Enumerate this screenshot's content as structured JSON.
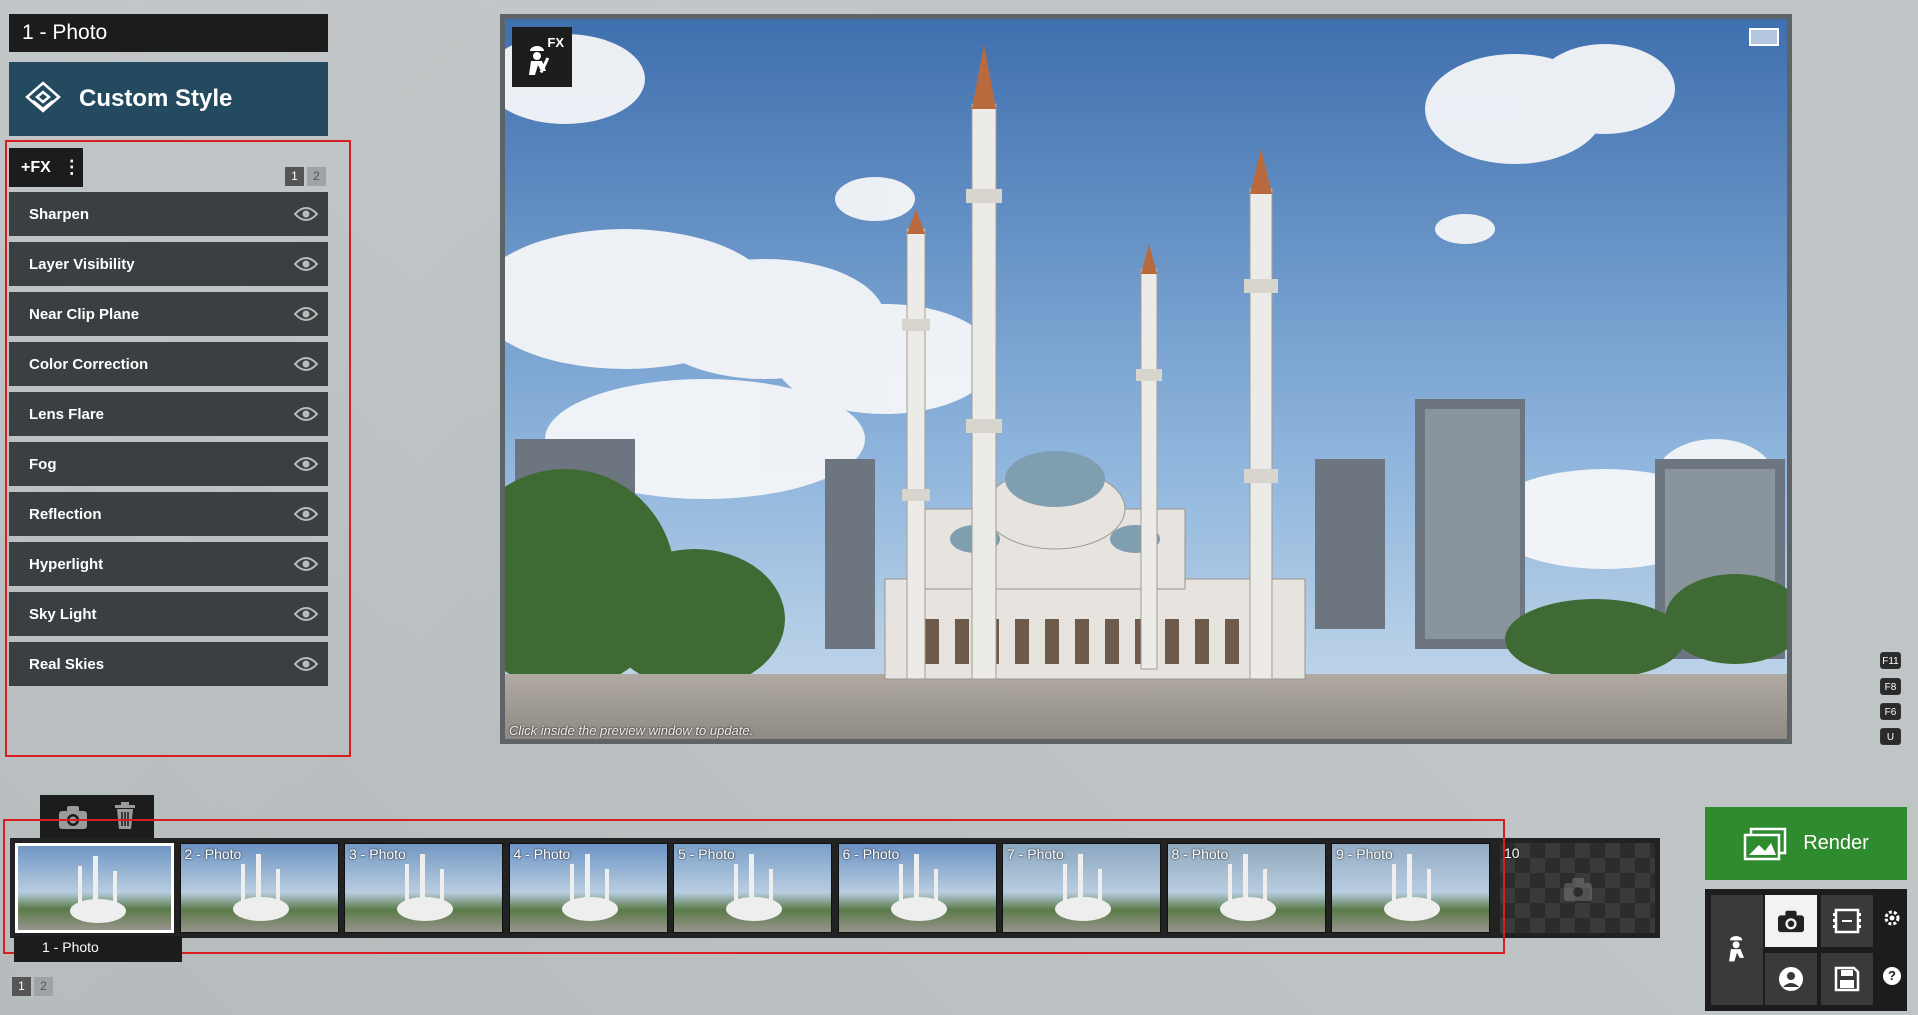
{
  "title_bar": {
    "text": "1 - Photo"
  },
  "style_header": {
    "label": "Custom Style",
    "icon": "style-layers-icon"
  },
  "fx_panel": {
    "add_label": "+FX",
    "pages": [
      "1",
      "2"
    ],
    "active_page": "1",
    "items": [
      {
        "label": "Sharpen"
      },
      {
        "label": "Layer Visibility"
      },
      {
        "label": "Near Clip Plane"
      },
      {
        "label": "Color Correction"
      },
      {
        "label": "Lens Flare"
      },
      {
        "label": "Fog"
      },
      {
        "label": "Reflection"
      },
      {
        "label": "Hyperlight"
      },
      {
        "label": "Sky Light"
      },
      {
        "label": "Real Skies"
      }
    ]
  },
  "preview": {
    "badge": "FX",
    "hint": "Click inside the preview window to update."
  },
  "hotkeys": [
    "F11",
    "F8",
    "F6",
    "U"
  ],
  "shots": {
    "thumbnails": [
      {
        "label": "1 - Photo"
      },
      {
        "label": "2 - Photo"
      },
      {
        "label": "3 - Photo"
      },
      {
        "label": "4 - Photo"
      },
      {
        "label": "5 - Photo"
      },
      {
        "label": "6 - Photo"
      },
      {
        "label": "7 - Photo"
      },
      {
        "label": "8 - Photo"
      },
      {
        "label": "9 - Photo"
      },
      {
        "label": "10"
      }
    ],
    "selected_caption": "1 - Photo",
    "pages": [
      "1",
      "2"
    ]
  },
  "render": {
    "label": "Render"
  },
  "colors": {
    "accent_green": "#2e8b2e",
    "header_blue": "#244a60",
    "highlight_red": "#d81e1e"
  }
}
